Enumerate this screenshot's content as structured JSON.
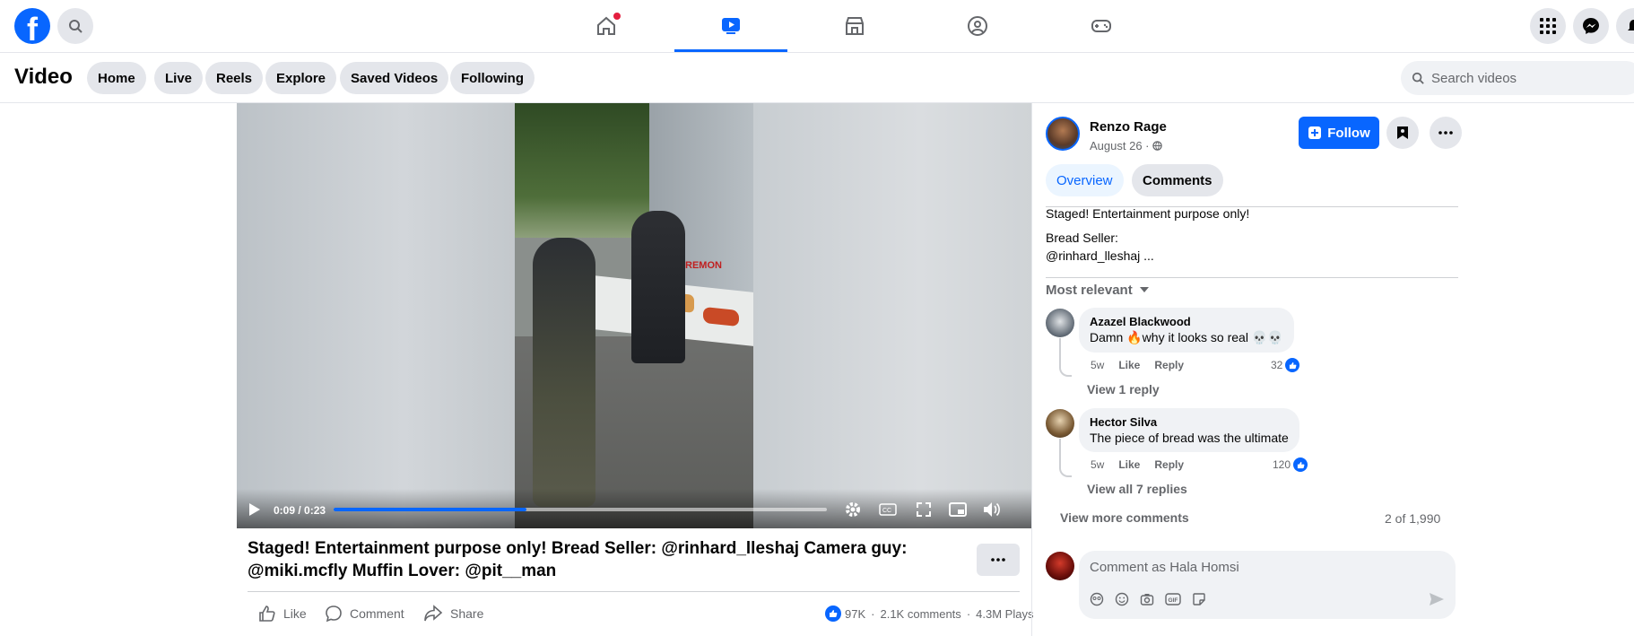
{
  "topnav": {
    "logo_letter": "f",
    "tabs": [
      "home-icon",
      "video-icon",
      "marketplace-icon",
      "groups-icon",
      "gaming-icon"
    ],
    "active_tab": "video-icon"
  },
  "subnav": {
    "title": "Video",
    "pills": [
      "Home",
      "Live",
      "Reels",
      "Explore",
      "Saved Videos",
      "Following"
    ],
    "search_placeholder": "Search videos"
  },
  "player": {
    "time": "0:09 / 0:23",
    "progress_fraction": 0.391,
    "truck_text": "REMON"
  },
  "post": {
    "caption": "Staged! Entertainment purpose only! Bread Seller: @rinhard_lleshaj Camera guy: @miki.mcfly Muffin Lover: @pit__man",
    "actions": {
      "like": "Like",
      "comment": "Comment",
      "share": "Share"
    },
    "stats": {
      "reactions": "97K",
      "comments": "2.1K comments",
      "plays": "4.3M Plays",
      "sep": "·"
    }
  },
  "sidebar": {
    "author": "Renzo Rage",
    "date": "August 26 ·",
    "follow_label": "Follow",
    "tabs": [
      "Overview",
      "Comments"
    ],
    "desc_line1": "Staged! Entertainment purpose only!",
    "desc_line2": "Bread Seller:",
    "desc_line3": "@rinhard_lleshaj ...",
    "sort_label": "Most relevant",
    "comments": [
      {
        "name": "Azazel Blackwood",
        "text": "Damn 🔥why it looks so real 💀💀",
        "time": "5w",
        "like": "Like",
        "reply": "Reply",
        "likes": "32",
        "view_replies": "View 1 reply"
      },
      {
        "name": "Hector Silva",
        "text": "The piece of bread was the ultimate",
        "time": "5w",
        "like": "Like",
        "reply": "Reply",
        "likes": "120",
        "view_replies": "View all 7 replies"
      }
    ],
    "view_more": "View more comments",
    "count": "2 of 1,990",
    "comment_placeholder": "Comment as Hala Homsi"
  }
}
